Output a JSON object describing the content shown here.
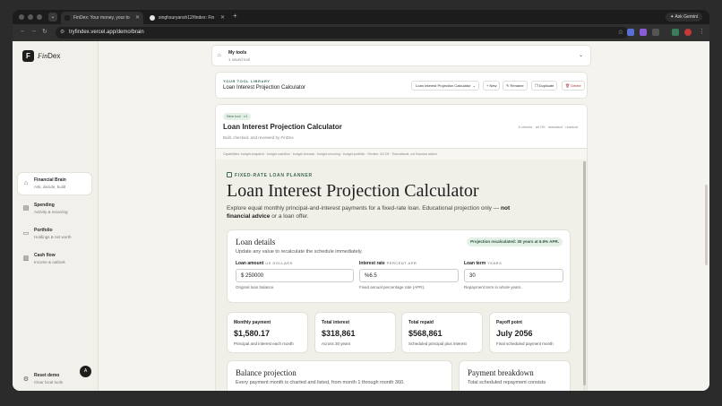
{
  "browser": {
    "tabs": [
      {
        "title": "FinDex: Your money, your to"
      },
      {
        "title": "singhsuryansh12/findex: Fin"
      }
    ],
    "url": "tryfindex.vercel.app/demo/brain",
    "gemini_label": "Ask Gemini"
  },
  "sidebar": {
    "brand": {
      "mark": "F",
      "name_italic": "Fin",
      "name_rest": "Dex"
    },
    "items": [
      {
        "title": "Financial Brain",
        "subtitle": "Ask, decide, build"
      },
      {
        "title": "Spending",
        "subtitle": "Activity & recurring"
      },
      {
        "title": "Portfolio",
        "subtitle": "Holdings & net worth"
      },
      {
        "title": "Cash flow",
        "subtitle": "Income & outlook"
      }
    ],
    "reset": {
      "title": "Reset demo",
      "subtitle": "Clear local tools"
    },
    "avatar": "A"
  },
  "mytools": {
    "title": "My tools",
    "subtitle": "1 saved tool"
  },
  "library": {
    "label": "YOUR TOOL LIBRARY",
    "name": "Loan Interest Projection Calculator",
    "select_value": "Loan Interest Projection Calculator",
    "buttons": {
      "new": "+ New",
      "rename": "Rename",
      "duplicate": "Duplicate",
      "delete": "Delete"
    }
  },
  "tool": {
    "badge": "New tool · v1",
    "title": "Loan Interest Projection Calculator",
    "subtitle": "Built, checked, and reviewed by FinDex",
    "meta": "8 checks   ·   all OK   ·   standard   ·   readout",
    "capabilities": "Capabilities: budget-snapshot · budget-cashflow · budget-forecast · budget-recurring · budget-portfolio   ·   Review: 4/4 OK   ·   Educational, not financial advice"
  },
  "calculator": {
    "eyebrow": "FIXED-RATE LOAN PLANNER",
    "title": "Loan Interest Projection Calculator",
    "description_start": "Explore equal monthly principal-and-interest payments for a fixed-rate loan. Educational projection only — ",
    "description_bold": "not financial advice",
    "description_end": " or a loan offer.",
    "loan_details": {
      "title": "Loan details",
      "subtitle": "Update any value to recalculate the schedule immediately.",
      "status": "Projection recalculated: 30 years at 6.5% APR.",
      "fields": [
        {
          "label": "Loan amount",
          "unit": "US DOLLARS",
          "value": "$ 250000",
          "hint": "Original loan balance."
        },
        {
          "label": "Interest rate",
          "unit": "PERCENT APR",
          "value": "%6.5",
          "hint": "Fixed annual percentage rate (APR)."
        },
        {
          "label": "Loan term",
          "unit": "YEARS",
          "value": "30",
          "hint": "Repayment term in whole years."
        }
      ]
    },
    "stats": [
      {
        "label": "Monthly payment",
        "value": "$1,580.17",
        "desc": "Principal and interest each month"
      },
      {
        "label": "Total interest",
        "value": "$318,861",
        "desc": "Across 30 years"
      },
      {
        "label": "Total repaid",
        "value": "$568,861",
        "desc": "Scheduled principal plus interest"
      },
      {
        "label": "Payoff point",
        "value": "July 2056",
        "desc": "Final scheduled payment month"
      }
    ],
    "balance": {
      "title": "Balance projection",
      "subtitle": "Every payment month is charted and listed, from month 1 through month 360."
    },
    "breakdown": {
      "title": "Payment breakdown",
      "subtitle": "Total scheduled repayment consists"
    }
  }
}
